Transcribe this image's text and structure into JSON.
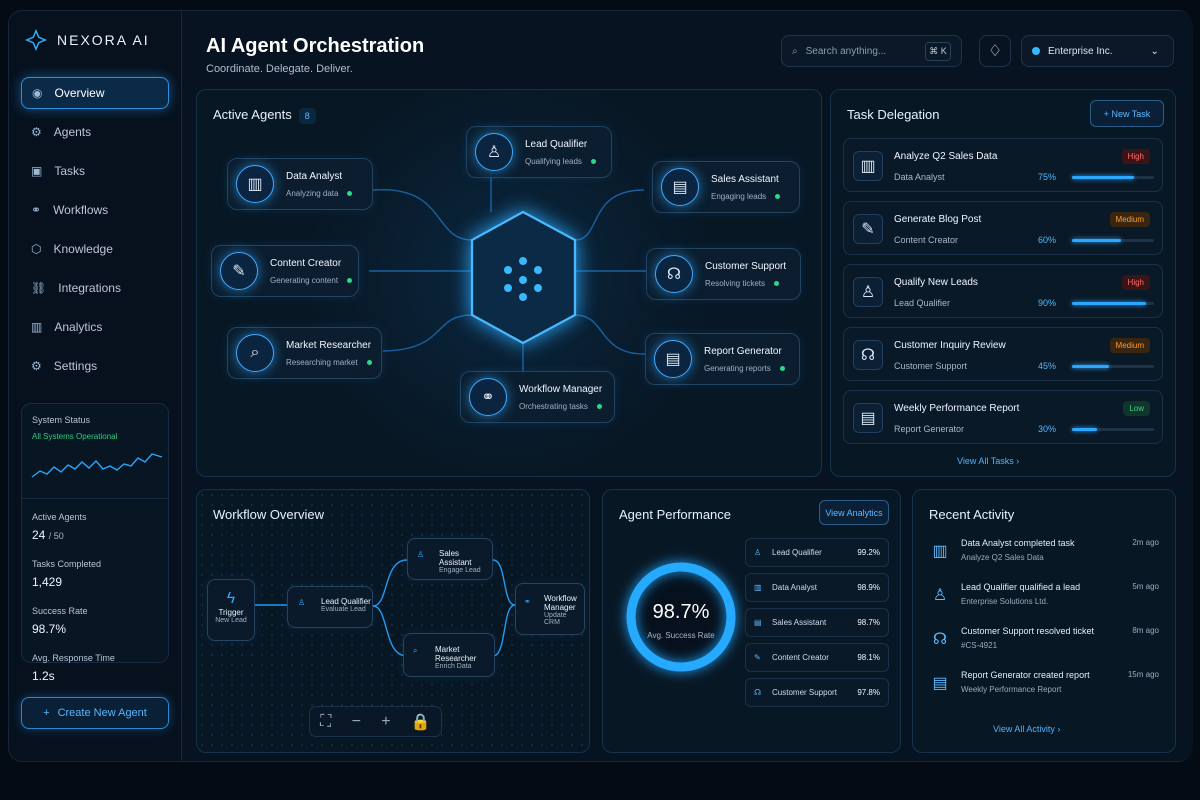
{
  "app": {
    "brand": "NEXORA AI",
    "title": "AI Agent Orchestration",
    "subtitle": "Coordinate. Delegate. Deliver."
  },
  "search": {
    "placeholder": "Search anything...",
    "shortcut": "⌘ K"
  },
  "org": {
    "name": "Enterprise Inc."
  },
  "sidebar": {
    "items": [
      {
        "label": "Overview",
        "icon": "overview-icon"
      },
      {
        "label": "Agents",
        "icon": "agents-icon"
      },
      {
        "label": "Tasks",
        "icon": "tasks-icon"
      },
      {
        "label": "Workflows",
        "icon": "workflows-icon"
      },
      {
        "label": "Knowledge",
        "icon": "knowledge-icon"
      },
      {
        "label": "Integrations",
        "icon": "integrations-icon"
      },
      {
        "label": "Analytics",
        "icon": "analytics-icon"
      },
      {
        "label": "Settings",
        "icon": "settings-icon"
      }
    ],
    "create": "Create New Agent"
  },
  "system": {
    "title": "System Status",
    "state": "All Systems Operational",
    "active_label": "Active Agents",
    "active_value": "24",
    "active_total": "/ 50",
    "tasks_label": "Tasks Completed",
    "tasks_value": "1,429",
    "success_label": "Success Rate",
    "success_value": "98.7%",
    "response_label": "Avg. Response Time",
    "response_value": "1.2s"
  },
  "active": {
    "title": "Active Agents",
    "count": "8",
    "agents": [
      {
        "name": "Data Analyst",
        "status": "Analyzing data"
      },
      {
        "name": "Lead Qualifier",
        "status": "Qualifying leads"
      },
      {
        "name": "Sales Assistant",
        "status": "Engaging leads"
      },
      {
        "name": "Content Creator",
        "status": "Generating content"
      },
      {
        "name": "Customer Support",
        "status": "Resolving tickets"
      },
      {
        "name": "Market Researcher",
        "status": "Researching market"
      },
      {
        "name": "Report Generator",
        "status": "Generating reports"
      },
      {
        "name": "Workflow Manager",
        "status": "Orchestrating tasks"
      }
    ]
  },
  "tasks": {
    "title": "Task Delegation",
    "new": "New Task",
    "view": "View All Tasks",
    "items": [
      {
        "name": "Analyze Q2 Sales Data",
        "agent": "Data Analyst",
        "priority": "High",
        "progress": "75%",
        "fraction": 0.75
      },
      {
        "name": "Generate Blog Post",
        "agent": "Content Creator",
        "priority": "Medium",
        "progress": "60%",
        "fraction": 0.6
      },
      {
        "name": "Qualify New Leads",
        "agent": "Lead Qualifier",
        "priority": "High",
        "progress": "90%",
        "fraction": 0.9
      },
      {
        "name": "Customer Inquiry Review",
        "agent": "Customer Support",
        "priority": "Medium",
        "progress": "45%",
        "fraction": 0.45
      },
      {
        "name": "Weekly Performance Report",
        "agent": "Report Generator",
        "priority": "Low",
        "progress": "30%",
        "fraction": 0.3
      }
    ]
  },
  "workflow": {
    "title": "Workflow Overview",
    "nodes": [
      {
        "name": "Trigger",
        "sub": "New Lead"
      },
      {
        "name": "Lead Qualifier",
        "sub": "Evaluate Lead"
      },
      {
        "name": "Sales Assistant",
        "sub": "Engage Lead"
      },
      {
        "name": "Market Researcher",
        "sub": "Enrich Data"
      },
      {
        "name": "Workflow Manager",
        "sub": "Update CRM"
      }
    ]
  },
  "performance": {
    "title": "Agent Performance",
    "button": "View Analytics",
    "value": "98.7%",
    "label": "Avg. Success Rate",
    "items": [
      {
        "name": "Lead Qualifier",
        "value": "99.2%"
      },
      {
        "name": "Data Analyst",
        "value": "98.9%"
      },
      {
        "name": "Sales Assistant",
        "value": "98.7%"
      },
      {
        "name": "Content Creator",
        "value": "98.1%"
      },
      {
        "name": "Customer Support",
        "value": "97.8%"
      }
    ]
  },
  "activity": {
    "title": "Recent Activity",
    "view": "View All Activity",
    "items": [
      {
        "text": "Data Analyst completed task",
        "sub": "Analyze Q2 Sales Data",
        "time": "2m ago"
      },
      {
        "text": "Lead Qualifier qualified a lead",
        "sub": "Enterprise Solutions Ltd.",
        "time": "5m ago"
      },
      {
        "text": "Customer Support resolved ticket",
        "sub": "#CS-4921",
        "time": "8m ago"
      },
      {
        "text": "Report Generator created report",
        "sub": "Weekly Performance Report",
        "time": "15m ago"
      }
    ]
  }
}
